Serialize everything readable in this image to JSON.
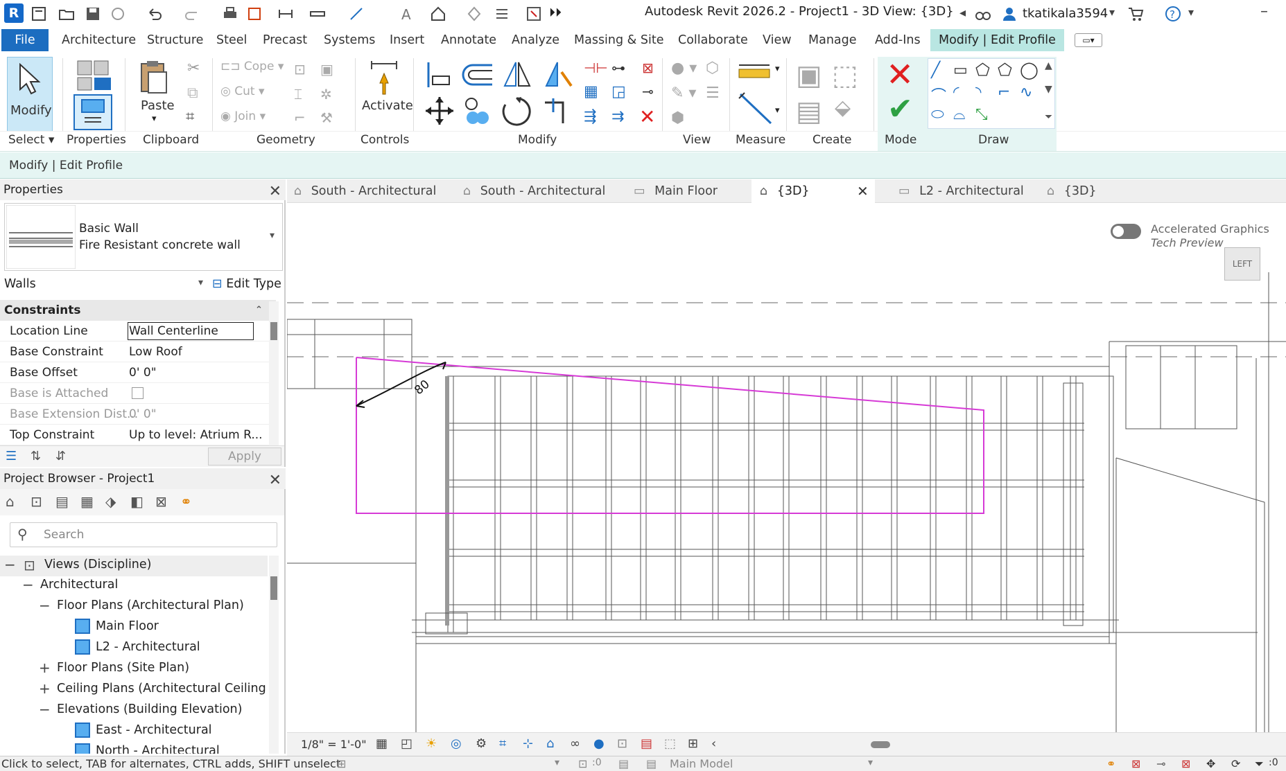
{
  "app": {
    "logo_letter": "R",
    "title": "Autodesk Revit 2026.2 - Project1 - 3D View: {3D}",
    "user": "tkatikala3594"
  },
  "menu": {
    "tabs": [
      "File",
      "Architecture",
      "Structure",
      "Steel",
      "Precast",
      "Systems",
      "Insert",
      "Annotate",
      "Analyze",
      "Massing & Site",
      "Collaborate",
      "View",
      "Manage",
      "Add-Ins",
      "Modify | Edit Profile"
    ],
    "active": "Modify | Edit Profile"
  },
  "ribbon": {
    "modify_label": "Modify",
    "properties_label": "Properties",
    "paste_label": "Paste",
    "cope_label": "Cope",
    "cut_label": "Cut",
    "join_label": "Join",
    "activate_label": "Activate",
    "panels": {
      "select": "Select",
      "properties": "Properties",
      "clipboard": "Clipboard",
      "geometry": "Geometry",
      "controls": "Controls",
      "modify": "Modify",
      "view": "View",
      "measure": "Measure",
      "create": "Create",
      "mode": "Mode",
      "draw": "Draw"
    }
  },
  "context_bar": {
    "text": "Modify | Edit Profile"
  },
  "properties": {
    "title": "Properties",
    "family": "Basic Wall",
    "type": "Fire  Resistant concrete wall",
    "category": "Walls",
    "edit_type": "Edit Type",
    "section": "Constraints",
    "rows": [
      {
        "name": "Location Line",
        "value": "Wall Centerline",
        "enabled": true
      },
      {
        "name": "Base Constraint",
        "value": "Low Roof",
        "enabled": true
      },
      {
        "name": "Base Offset",
        "value": "0'  0\"",
        "enabled": true
      },
      {
        "name": "Base is Attached",
        "value": "",
        "enabled": false
      },
      {
        "name": "Base Extension Dist...",
        "value": "0'  0\"",
        "enabled": false
      },
      {
        "name": "Top Constraint",
        "value": "Up to level: Atrium R...",
        "enabled": true
      }
    ],
    "apply": "Apply"
  },
  "browser": {
    "title": "Project Browser - Project1",
    "search_placeholder": "Search",
    "tree": [
      {
        "label": "Views (Discipline)",
        "level": 0,
        "sign": "−"
      },
      {
        "label": "Architectural",
        "level": 1,
        "sign": "−"
      },
      {
        "label": "Floor Plans (Architectural Plan)",
        "level": 2,
        "sign": "−"
      },
      {
        "label": "Main Floor",
        "level": 3,
        "sign": ""
      },
      {
        "label": "L2 - Architectural",
        "level": 3,
        "sign": ""
      },
      {
        "label": "Floor Plans (Site Plan)",
        "level": 2,
        "sign": "+"
      },
      {
        "label": "Ceiling Plans (Architectural Ceiling Pla",
        "level": 2,
        "sign": "+"
      },
      {
        "label": "Elevations (Building Elevation)",
        "level": 2,
        "sign": "−"
      },
      {
        "label": "East - Architectural",
        "level": 3,
        "sign": ""
      },
      {
        "label": "North - Architectural",
        "level": 3,
        "sign": ""
      }
    ]
  },
  "view_tabs": [
    {
      "label": "South - Architectural",
      "active": false
    },
    {
      "label": "South - Architectural",
      "active": false
    },
    {
      "label": "Main Floor",
      "active": false
    },
    {
      "label": "{3D}",
      "active": true
    },
    {
      "label": "L2 - Architectural",
      "active": false
    },
    {
      "label": "{3D}",
      "active": false
    }
  ],
  "canvas": {
    "graphics_toggle_line1": "Accelerated Graphics",
    "graphics_toggle_line2": "Tech Preview",
    "viewcube_face": "LEFT",
    "angle_dimension": "80",
    "profile_color": "#d63ad6"
  },
  "view_bar": {
    "scale": "1/8\" = 1'-0\""
  },
  "status": {
    "text": "Click to select, TAB for alternates, CTRL adds, SHIFT unselect",
    "model": "Main Model",
    "counter1": ":0",
    "counter2": ":0"
  },
  "colors": {
    "file_tab": "#1c6dc0",
    "context_tab": "#b9e6e2",
    "context_bar": "#e5f5f3",
    "cancel_red": "#e02020",
    "finish_green": "#2ea043"
  }
}
